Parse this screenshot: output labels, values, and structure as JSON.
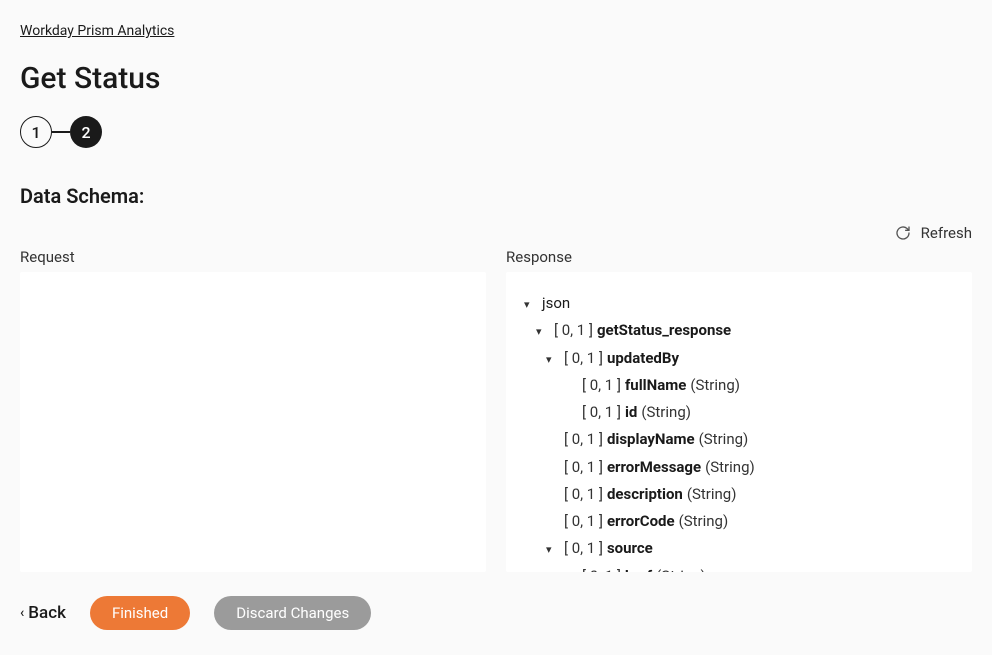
{
  "breadcrumb": {
    "label": "Workday Prism Analytics"
  },
  "page": {
    "title": "Get Status"
  },
  "stepper": {
    "step1": "1",
    "step2": "2"
  },
  "section": {
    "heading": "Data Schema:"
  },
  "actions": {
    "refresh": "Refresh"
  },
  "panels": {
    "request_label": "Request",
    "response_label": "Response"
  },
  "tree": {
    "root": "json",
    "range": "[ 0, 1 ]",
    "nodes": {
      "getStatus_response": "getStatus_response",
      "updatedBy": "updatedBy",
      "fullName": "fullName",
      "id": "id",
      "displayName": "displayName",
      "errorMessage": "errorMessage",
      "description": "description",
      "errorCode": "errorCode",
      "source": "source",
      "href": "href"
    },
    "types": {
      "string": "(String)"
    }
  },
  "footer": {
    "back": "Back",
    "finished": "Finished",
    "discard": "Discard Changes"
  }
}
